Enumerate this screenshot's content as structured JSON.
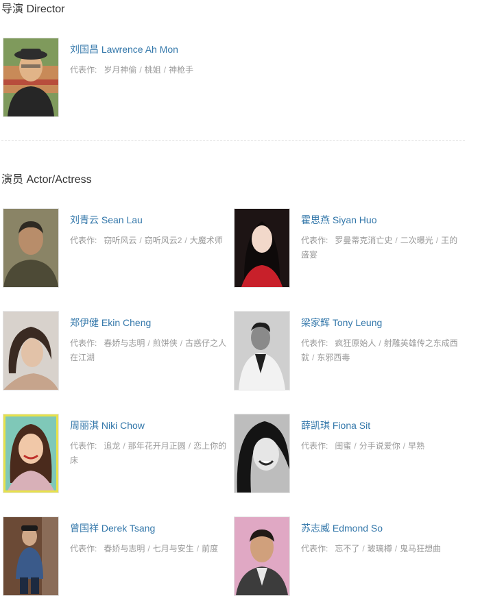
{
  "director_section": {
    "heading": "导演 Director",
    "people": [
      {
        "name": "刘国昌 Lawrence Ah Mon",
        "works_label": "代表作:",
        "works": [
          "岁月神偷",
          "桃姐",
          "神枪手"
        ],
        "photo": "director-photo"
      }
    ]
  },
  "actor_section": {
    "heading": "演员 Actor/Actress",
    "people": [
      {
        "name": "刘青云 Sean Lau",
        "works_label": "代表作:",
        "works": [
          "窃听风云",
          "窃听风云2",
          "大魔术师"
        ],
        "photo": "actor-photo"
      },
      {
        "name": "霍思燕 Siyan Huo",
        "works_label": "代表作:",
        "works": [
          "罗曼蒂克消亡史",
          "二次曝光",
          "王的盛宴"
        ],
        "photo": "actress-photo"
      },
      {
        "name": "郑伊健 Ekin Cheng",
        "works_label": "代表作:",
        "works": [
          "春娇与志明",
          "煎饼侠",
          "古惑仔之人在江湖"
        ],
        "photo": "actor-photo"
      },
      {
        "name": "梁家辉 Tony Leung",
        "works_label": "代表作:",
        "works": [
          "疯狂原始人",
          "射雕英雄传之东成西就",
          "东邪西毒"
        ],
        "photo": "actor-photo"
      },
      {
        "name": "周丽淇 Niki Chow",
        "works_label": "代表作:",
        "works": [
          "追龙",
          "那年花开月正圆",
          "恋上你的床"
        ],
        "photo": "actress-photo"
      },
      {
        "name": "薛凯琪 Fiona Sit",
        "works_label": "代表作:",
        "works": [
          "闺蜜",
          "分手说爱你",
          "早熟"
        ],
        "photo": "actress-photo"
      },
      {
        "name": "曾国祥 Derek Tsang",
        "works_label": "代表作:",
        "works": [
          "春娇与志明",
          "七月与安生",
          "前度"
        ],
        "photo": "actor-photo"
      },
      {
        "name": "苏志威 Edmond So",
        "works_label": "代表作:",
        "works": [
          "忘不了",
          "玻璃樽",
          "鬼马狂想曲"
        ],
        "photo": "actor-photo"
      }
    ]
  },
  "colors": {
    "link": "#3377aa",
    "muted": "#999999",
    "heading": "#333333"
  }
}
